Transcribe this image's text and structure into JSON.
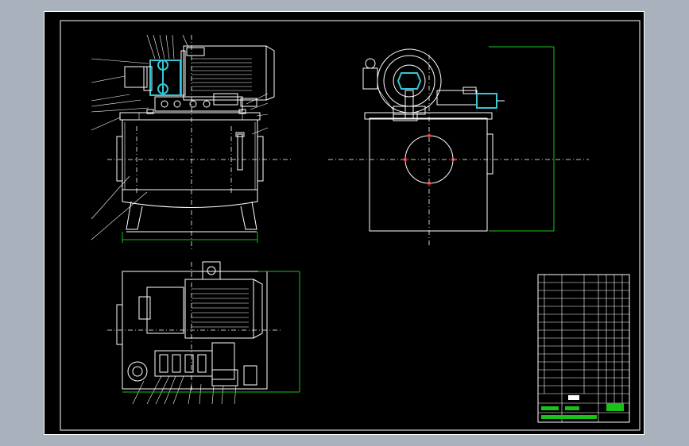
{
  "drawing": {
    "background": "#000000",
    "viewport_bg": "#a9b1bd",
    "line_color": "#ffffff",
    "dimension_color": "#19c219",
    "highlight_color": "#35c6d6",
    "hole_color": "#e02a2a"
  },
  "views": {
    "front": {
      "name": "front-view"
    },
    "side": {
      "name": "side-view"
    },
    "top": {
      "name": "top-view"
    }
  },
  "title_block": {
    "name": "title-block"
  }
}
